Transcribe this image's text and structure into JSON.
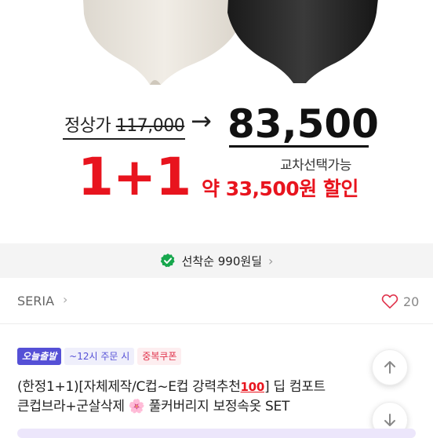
{
  "promo": {
    "original_label": "정상가",
    "original_price": "117,000",
    "arrow": "→",
    "sale_price": "83,500",
    "bundle": "1+1",
    "mix_note": "교차선택가능",
    "discount": "약 33,500원 할인"
  },
  "banner": {
    "text": "선착순 990원딜",
    "chevron": "›"
  },
  "seller": {
    "name": "SERIA",
    "chevron": "›",
    "likes": "20"
  },
  "badges": {
    "today_ship": "오늘출발",
    "order_time": "~12시 주문 시",
    "coupon": "중복쿠폰"
  },
  "product": {
    "title_part1": "(한정1+1)[자체제작/C컵~E컵 강력추천",
    "emoji_hundred": "100",
    "title_part2": "] 딥 컴포트",
    "title_line2_part1": "큰컵브라+군살삭제 ",
    "emoji_flower": "🌸",
    "title_line2_part2": " 풀커버리지 보정속옷 SET"
  },
  "colors": {
    "accent_red": "#e8141e",
    "badge_purple": "#5550d6",
    "check_green": "#17a74d"
  },
  "icons": [
    "check-badge-icon",
    "heart-icon",
    "arrow-up-icon",
    "arrow-down-icon"
  ]
}
